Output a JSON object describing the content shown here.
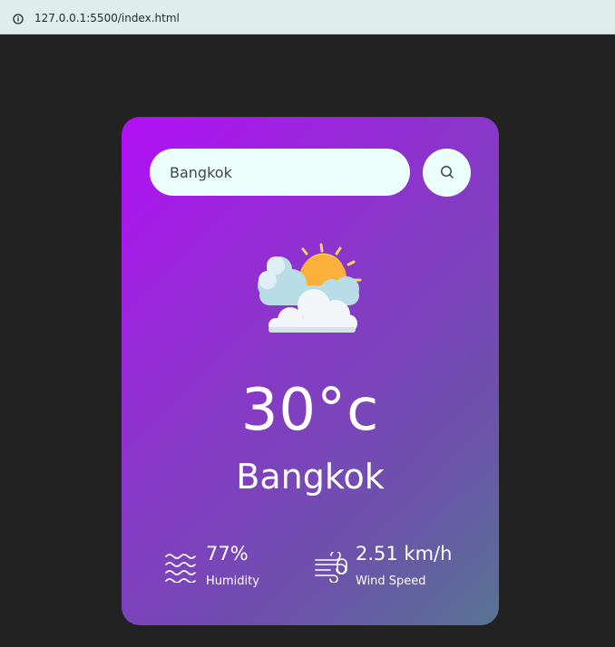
{
  "browser": {
    "url": "127.0.0.1:5500/index.html",
    "icon": "info-icon"
  },
  "search": {
    "value": "Bangkok",
    "placeholder": "",
    "button_icon": "search-icon"
  },
  "weather": {
    "icon": "partly-cloudy-icon",
    "temperature": "30°c",
    "city": "Bangkok"
  },
  "details": {
    "humidity": {
      "icon": "humidity-icon",
      "value": "77%",
      "label": "Humidity"
    },
    "wind": {
      "icon": "wind-icon",
      "value": "2.51 km/h",
      "label": "Wind Speed"
    }
  },
  "colors": {
    "page_background": "#222222",
    "card_gradient_start": "#b30ff7",
    "card_gradient_end": "#577493",
    "input_background": "#ebfffc",
    "text": "#ffffff"
  }
}
